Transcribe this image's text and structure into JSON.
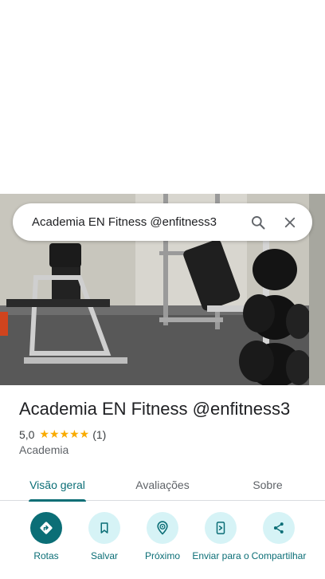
{
  "search": {
    "query": "Academia EN Fitness @enfitness3",
    "search_icon": "search-icon",
    "close_icon": "close-icon"
  },
  "place": {
    "title": "Academia EN Fitness @enfitness3",
    "rating": "5,0",
    "stars": "★★★★★",
    "review_count": "(1)",
    "category": "Academia"
  },
  "tabs": [
    {
      "label": "Visão geral",
      "active": true
    },
    {
      "label": "Avaliações",
      "active": false
    },
    {
      "label": "Sobre",
      "active": false
    }
  ],
  "actions": [
    {
      "label": "Rotas",
      "icon": "directions-icon"
    },
    {
      "label": "Salvar",
      "icon": "bookmark-icon"
    },
    {
      "label": "Próximo",
      "icon": "nearby-icon"
    },
    {
      "label": "Enviar para o",
      "icon": "send-to-phone-icon"
    },
    {
      "label": "Compartilhar",
      "icon": "share-icon"
    }
  ],
  "colors": {
    "accent": "#0b6e76",
    "action_bg": "#d6f3f6",
    "star": "#f9ab00"
  }
}
